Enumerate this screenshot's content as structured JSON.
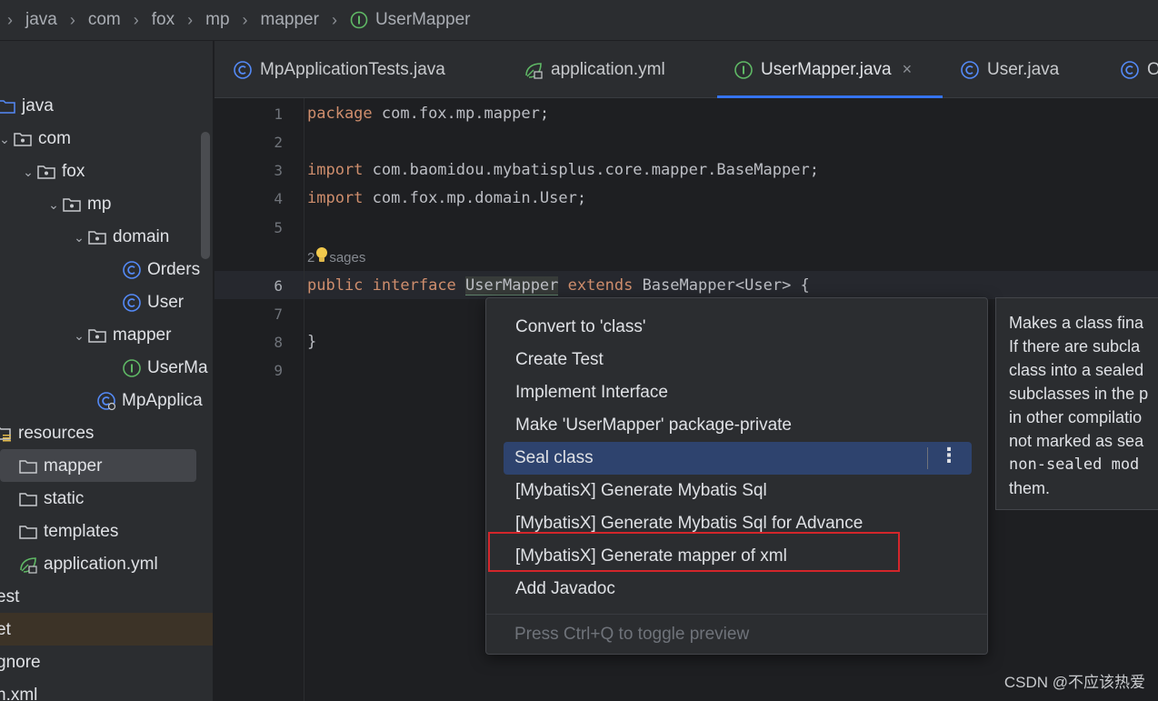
{
  "breadcrumb": [
    "java",
    "com",
    "fox",
    "mp",
    "mapper",
    "UserMapper"
  ],
  "tree": [
    {
      "label": "java",
      "indent": 0
    },
    {
      "label": "com",
      "indent": 1
    },
    {
      "label": "fox",
      "indent": 2
    },
    {
      "label": "mp",
      "indent": 3
    },
    {
      "label": "domain",
      "indent": 4
    },
    {
      "label": "Orders",
      "indent": 5
    },
    {
      "label": "User",
      "indent": 5
    },
    {
      "label": "mapper",
      "indent": 4
    },
    {
      "label": "UserMa",
      "indent": 5
    },
    {
      "label": "MpApplica",
      "indent": 4
    },
    {
      "label": "resources",
      "indent": 0
    },
    {
      "label": "mapper",
      "indent": 1
    },
    {
      "label": "static",
      "indent": 1
    },
    {
      "label": "templates",
      "indent": 1
    },
    {
      "label": "application.yml",
      "indent": 1
    },
    {
      "label": "est",
      "indent": 0
    },
    {
      "label": "et",
      "indent": 0
    },
    {
      "label": "gnore",
      "indent": 0
    },
    {
      "label": "n.xml",
      "indent": 0
    }
  ],
  "tabs": [
    {
      "label": "MpApplicationTests.java",
      "icon": "class-icon"
    },
    {
      "label": "application.yml",
      "icon": "yml-icon"
    },
    {
      "label": "UserMapper.java",
      "icon": "interface-icon",
      "active": true,
      "close": "×"
    },
    {
      "label": "User.java",
      "icon": "class-icon"
    },
    {
      "label": "O",
      "icon": "class-icon"
    }
  ],
  "editor": {
    "line_numbers": [
      "1",
      "2",
      "3",
      "4",
      "5",
      "6",
      "7",
      "8",
      "9"
    ],
    "line1": {
      "kw": "package",
      "rest": " com.fox.mp.mapper;"
    },
    "line3": {
      "kw": "import",
      "rest": " com.baomidou.mybatisplus.core.mapper.BaseMapper;"
    },
    "line4": {
      "kw": "import",
      "rest": " com.fox.mp.domain.User;"
    },
    "usages_hint": {
      "pre": "2",
      "post": "sages"
    },
    "line6": {
      "kw1": "public",
      "kw2": "interface",
      "name": "UserMapper",
      "kw3": "extends",
      "rest": "BaseMapper<User> {"
    },
    "line8": "}"
  },
  "popup": {
    "items": [
      "Convert to 'class'",
      "Create Test",
      "Implement Interface",
      "Make 'UserMapper' package-private",
      "Seal class",
      "[MybatisX] Generate Mybatis Sql",
      "[MybatisX] Generate Mybatis Sql for Advance",
      "[MybatisX] Generate mapper of xml",
      "Add Javadoc"
    ],
    "selected_index": 4,
    "more": "⋮",
    "footer": "Press Ctrl+Q to toggle preview"
  },
  "preview": {
    "lines": [
      "Makes a class fina",
      "If there are subcla",
      "class into a sealed",
      "subclasses in the p",
      "in other compilatio",
      "not marked as sea",
      "non-sealed mod",
      "them."
    ]
  },
  "watermark": "CSDN @不应该热爱",
  "colors": {
    "keyword": "#cf8e6d",
    "selection": "#2e436e",
    "annotation_box": "#d3262b",
    "accent": "#3574f0"
  }
}
